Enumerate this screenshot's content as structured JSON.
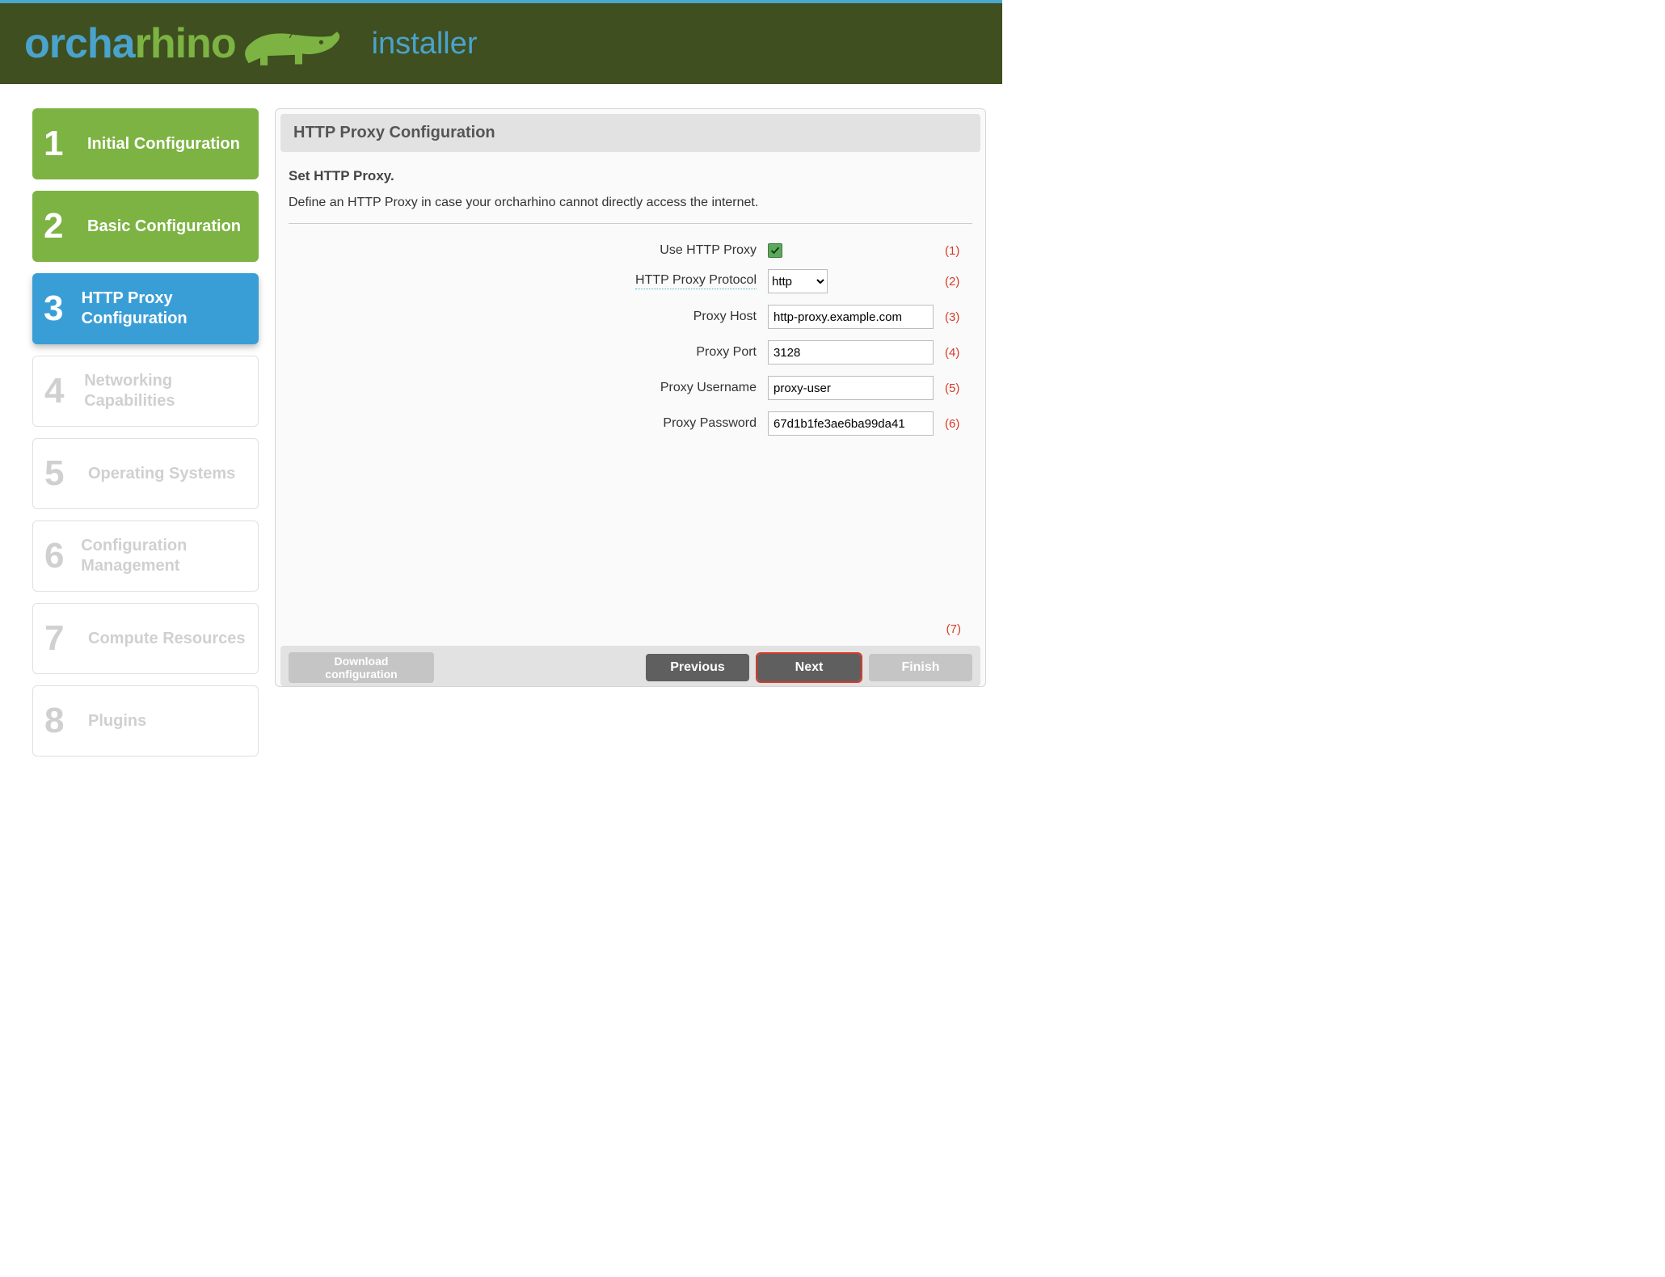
{
  "brand": {
    "part1": "orcha",
    "part2": "rhino",
    "tagline": "installer"
  },
  "sidebar": {
    "items": [
      {
        "num": "1",
        "label": "Initial Configuration",
        "state": "done"
      },
      {
        "num": "2",
        "label": "Basic Configuration",
        "state": "done"
      },
      {
        "num": "3",
        "label": "HTTP Proxy Configuration",
        "state": "active"
      },
      {
        "num": "4",
        "label": "Networking Capabilities",
        "state": "pending"
      },
      {
        "num": "5",
        "label": "Operating Systems",
        "state": "pending"
      },
      {
        "num": "6",
        "label": "Configuration Management",
        "state": "pending"
      },
      {
        "num": "7",
        "label": "Compute Resources",
        "state": "pending"
      },
      {
        "num": "8",
        "label": "Plugins",
        "state": "pending"
      }
    ]
  },
  "panel": {
    "title": "HTTP Proxy Configuration",
    "subtitle": "Set HTTP Proxy.",
    "description": "Define an HTTP Proxy in case your orcharhino cannot directly access the internet."
  },
  "form": {
    "use_proxy": {
      "label": "Use HTTP Proxy",
      "checked": true,
      "annot": "(1)"
    },
    "protocol": {
      "label": "HTTP Proxy Protocol",
      "value": "http",
      "options": [
        "http"
      ],
      "annot": "(2)"
    },
    "host": {
      "label": "Proxy Host",
      "value": "http-proxy.example.com",
      "annot": "(3)"
    },
    "port": {
      "label": "Proxy Port",
      "value": "3128",
      "annot": "(4)"
    },
    "username": {
      "label": "Proxy Username",
      "value": "proxy-user",
      "annot": "(5)"
    },
    "password": {
      "label": "Proxy Password",
      "value": "67d1b1fe3ae6ba99da41",
      "annot": "(6)"
    },
    "bottom_annot": "(7)"
  },
  "footer": {
    "download_l1": "Download",
    "download_l2": "configuration",
    "previous": "Previous",
    "next": "Next",
    "finish": "Finish"
  }
}
